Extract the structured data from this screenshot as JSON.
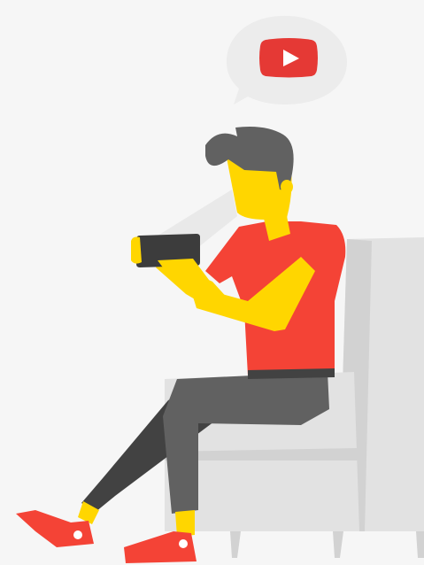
{
  "illustration": {
    "subject": "person-watching-phone-in-armchair",
    "icons": [
      "speech-bubble-icon",
      "play-button-icon"
    ]
  },
  "colors": {
    "background": "#f6f6f6",
    "bubble": "#ececec",
    "play_red": "#e53935",
    "play_triangle": "#ffffff",
    "skin": "#ffd600",
    "hair": "#616161",
    "shirt": "#f44336",
    "pants": "#616161",
    "pants_shadow": "#424242",
    "shoes": "#f44336",
    "shoe_sole": "#ffffff",
    "phone": "#3c3c3c",
    "chair": "#e2e2e2",
    "chair_shadow": "#d2d2d2",
    "chair_highlight": "#ececec",
    "light_beam": "#e9e9e9"
  }
}
